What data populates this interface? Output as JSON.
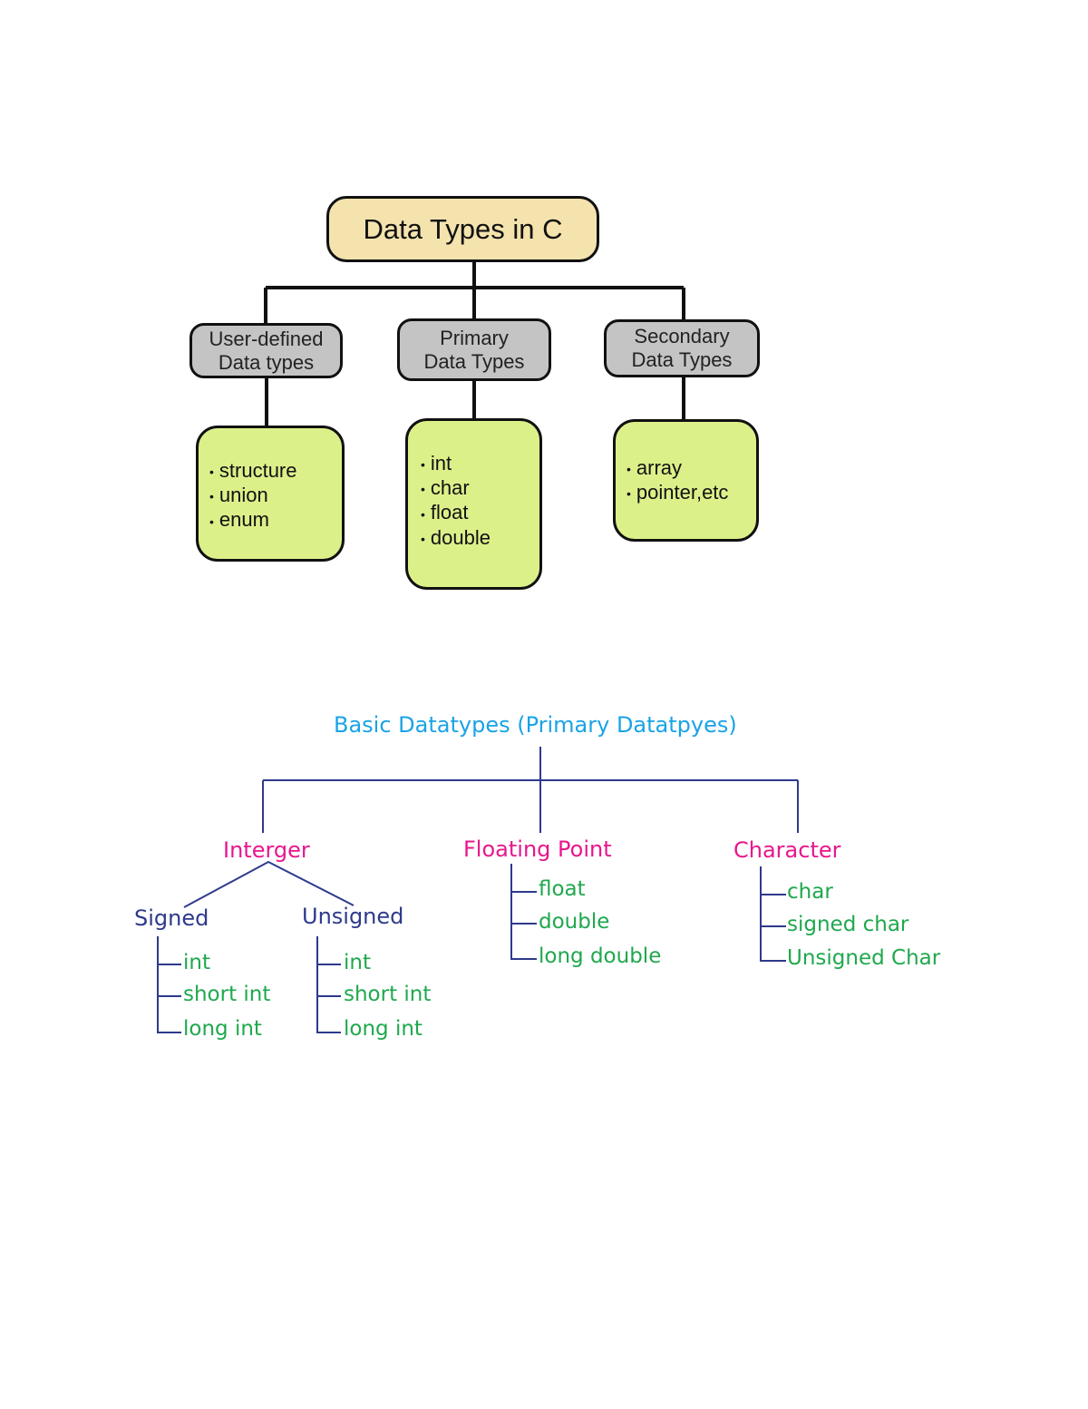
{
  "diagram1": {
    "root": "Data Types in C",
    "categories": [
      {
        "label_line1": "User-defined",
        "label_line2": "Data types",
        "items": [
          "structure",
          "union",
          "enum"
        ]
      },
      {
        "label_line1": "Primary",
        "label_line2": "Data Types",
        "items": [
          "int",
          "char",
          "float",
          "double"
        ]
      },
      {
        "label_line1": "Secondary",
        "label_line2": "Data Types",
        "items": [
          "array",
          "pointer,etc"
        ]
      }
    ],
    "colors": {
      "root_fill": "#f4e3ad",
      "category_fill": "#c4c4c4",
      "leaf_fill": "#dcf08a",
      "outline": "#111111"
    }
  },
  "diagram2": {
    "title": "Basic Datatypes (Primary Datatpyes)",
    "integer": {
      "label": "Interger",
      "signed": {
        "label": "Signed",
        "items": [
          "int",
          "short int",
          "long int"
        ]
      },
      "unsigned": {
        "label": "Unsigned",
        "items": [
          "int",
          "short int",
          "long int"
        ]
      }
    },
    "floating": {
      "label": "Floating Point",
      "items": [
        "float",
        "double",
        "long double"
      ]
    },
    "character": {
      "label": "Character",
      "items": [
        "char",
        "signed char",
        "Unsigned Char"
      ]
    },
    "colors": {
      "title": "#1aa3e6",
      "category": "#e8178c",
      "subcategory": "#2e3a8c",
      "item": "#1fa84d",
      "lines": "#2e3a8c"
    }
  }
}
